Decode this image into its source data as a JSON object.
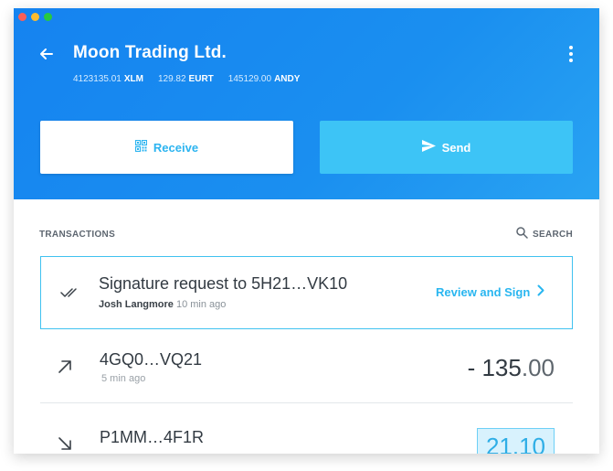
{
  "header": {
    "title": "Moon Trading Ltd.",
    "balances": [
      {
        "amount": "4123135.01",
        "currency": "XLM"
      },
      {
        "amount": "129.82",
        "currency": "EURT"
      },
      {
        "amount": "145129.00",
        "currency": "ANDY"
      }
    ],
    "receive_label": "Receive",
    "send_label": "Send"
  },
  "transactions": {
    "section_label": "TRANSACTIONS",
    "search_label": "SEARCH",
    "signature_request": {
      "title": "Signature request to 5H21…VK10",
      "author": "Josh Langmore",
      "time": "10 min ago",
      "action_label": "Review and Sign"
    },
    "items": [
      {
        "id": "4GQ0…VQ21",
        "time": "5 min ago",
        "amount_main": "- 135",
        "amount_dec": ".00",
        "direction": "outgoing"
      },
      {
        "id": "P1MM…4F1R",
        "time": "",
        "amount_main": "21",
        "amount_dec": ".10",
        "direction": "incoming"
      }
    ]
  },
  "icons": {
    "back": "arrow-left-icon",
    "menu": "more-vertical-icon",
    "receive": "qr-code-icon",
    "send": "send-icon",
    "search": "search-icon",
    "signature": "double-check-icon",
    "review": "chevron-right-icon",
    "outgoing": "arrow-up-right-icon",
    "incoming": "arrow-down-right-icon"
  },
  "colors": {
    "header_blue": "#1583f0",
    "accent": "#29b6f0",
    "send_button": "#3dc4f6"
  }
}
